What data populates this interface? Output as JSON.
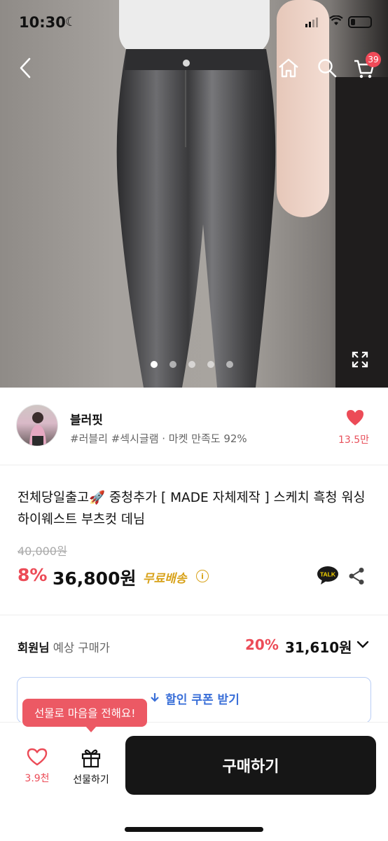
{
  "status_bar": {
    "time": "10:30"
  },
  "header": {
    "cart_count": "39"
  },
  "gallery": {
    "total": 5,
    "active_index": 0
  },
  "seller": {
    "name": "블러핏",
    "tags": "#러블리 #섹시글램 · 마켓 만족도 92%",
    "likes": "13.5만"
  },
  "product": {
    "title": "전체당일출고🚀 중청추가 [ MADE 자체제작 ] 스케치 흑청 워싱 하이웨스트 부츠컷 데님",
    "original_price": "40,000원",
    "discount_rate": "8%",
    "price": "36,800원",
    "shipping": "무료배송",
    "talk_label": "TALK"
  },
  "member": {
    "label_bold": "회원님",
    "label_rest": " 예상 구매가",
    "discount_rate": "20%",
    "price": "31,610원"
  },
  "coupon": {
    "label": "할인 쿠폰 받기"
  },
  "bottom_bar": {
    "wish_count": "3.9천",
    "gift_label": "선물하기",
    "buy_label": "구매하기",
    "tooltip": "선물로 마음을 전해요!"
  },
  "colors": {
    "accent": "#ec4b57",
    "brand_blue": "#3a6fd8",
    "ship_gold": "#d8a21a"
  }
}
